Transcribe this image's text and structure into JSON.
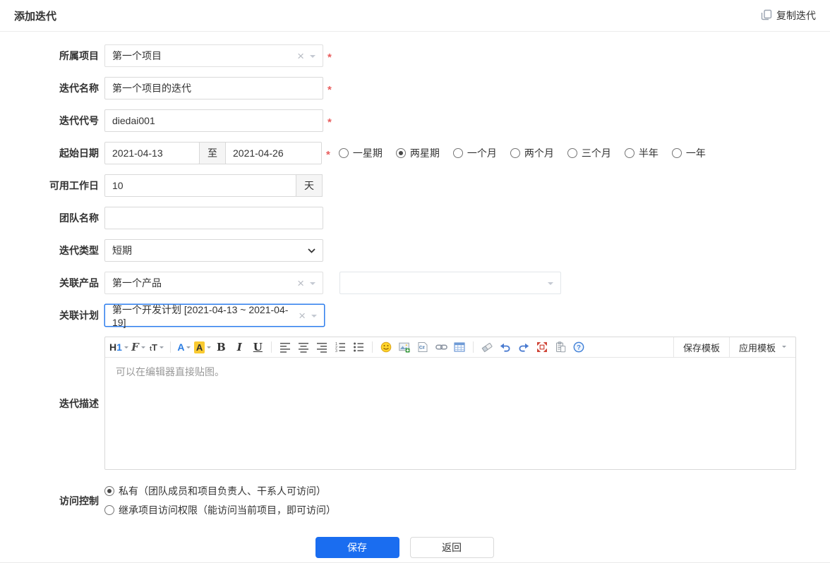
{
  "page": {
    "title": "添加迭代"
  },
  "header": {
    "copy_button_label": "复制迭代"
  },
  "colors": {
    "accent": "#2e7eed",
    "primary_button": "#1a6df0",
    "required_mark": "#e85d5d",
    "highlight_swatch": "#f9ca31"
  },
  "form": {
    "project": {
      "label": "所属项目",
      "value": "第一个项目",
      "required": "*"
    },
    "name": {
      "label": "迭代名称",
      "value": "第一个项目的迭代",
      "required": "*"
    },
    "code": {
      "label": "迭代代号",
      "value": "diedai001",
      "required": "*"
    },
    "dates": {
      "label": "起始日期",
      "begin": "2021-04-13",
      "separator": "至",
      "end": "2021-04-26",
      "required": "*",
      "duration_options": [
        {
          "label": "一星期",
          "selected": false
        },
        {
          "label": "两星期",
          "selected": true
        },
        {
          "label": "一个月",
          "selected": false
        },
        {
          "label": "两个月",
          "selected": false
        },
        {
          "label": "三个月",
          "selected": false
        },
        {
          "label": "半年",
          "selected": false
        },
        {
          "label": "一年",
          "selected": false
        }
      ]
    },
    "workdays": {
      "label": "可用工作日",
      "value": "10",
      "unit": "天"
    },
    "team": {
      "label": "团队名称",
      "value": ""
    },
    "type": {
      "label": "迭代类型",
      "value": "短期"
    },
    "product": {
      "label": "关联产品",
      "value": "第一个产品",
      "branch_value": ""
    },
    "plan": {
      "label": "关联计划",
      "value": "第一个开发计划 [2021-04-13 ~ 2021-04-19]"
    },
    "desc": {
      "label": "迭代描述",
      "placeholder": "可以在编辑器直接贴图。"
    },
    "acl": {
      "label": "访问控制",
      "options": [
        {
          "label": "私有（团队成员和项目负责人、干系人可访问）",
          "selected": true
        },
        {
          "label": "继承项目访问权限（能访问当前项目，即可访问）",
          "selected": false
        }
      ]
    }
  },
  "editor": {
    "toolbar_icons": [
      {
        "name": "heading-icon",
        "glyph": "H1",
        "cls": "g-h1",
        "caret": true
      },
      {
        "name": "font-family-icon",
        "glyph": "F",
        "cls": "g-script",
        "caret": true
      },
      {
        "name": "font-size-icon",
        "glyph": "tT",
        "cls": "g-tt",
        "caret": true
      },
      {
        "name": "sep"
      },
      {
        "name": "text-color-icon",
        "glyph": "A",
        "cls": "g-fore",
        "caret": true
      },
      {
        "name": "highlight-color-icon",
        "glyph": "A",
        "cls": "g-hilite",
        "caret": true
      },
      {
        "name": "bold-icon",
        "glyph": "B",
        "cls": "g-bold"
      },
      {
        "name": "italic-icon",
        "glyph": "I",
        "cls": "g-italic"
      },
      {
        "name": "underline-icon",
        "glyph": "U",
        "cls": "g-underline"
      },
      {
        "name": "sep"
      },
      {
        "name": "align-left-icon",
        "svg": true
      },
      {
        "name": "align-center-icon",
        "svg": true
      },
      {
        "name": "align-right-icon",
        "svg": true
      },
      {
        "name": "ordered-list-icon",
        "svg": true
      },
      {
        "name": "unordered-list-icon",
        "svg": true
      },
      {
        "name": "sep"
      },
      {
        "name": "emoji-icon",
        "svg": true
      },
      {
        "name": "image-icon",
        "svg": true
      },
      {
        "name": "code-icon",
        "svg": true
      },
      {
        "name": "link-icon",
        "svg": true
      },
      {
        "name": "table-icon",
        "svg": true
      },
      {
        "name": "sep"
      },
      {
        "name": "eraser-icon",
        "svg": true
      },
      {
        "name": "undo-icon",
        "svg": true
      },
      {
        "name": "redo-icon",
        "svg": true
      },
      {
        "name": "fullscreen-icon",
        "svg": true
      },
      {
        "name": "paste-icon",
        "svg": true
      },
      {
        "name": "help-icon",
        "svg": true
      }
    ],
    "template_buttons": {
      "save": "保存模板",
      "apply": "应用模板"
    }
  },
  "actions": {
    "save": "保存",
    "back": "返回"
  }
}
